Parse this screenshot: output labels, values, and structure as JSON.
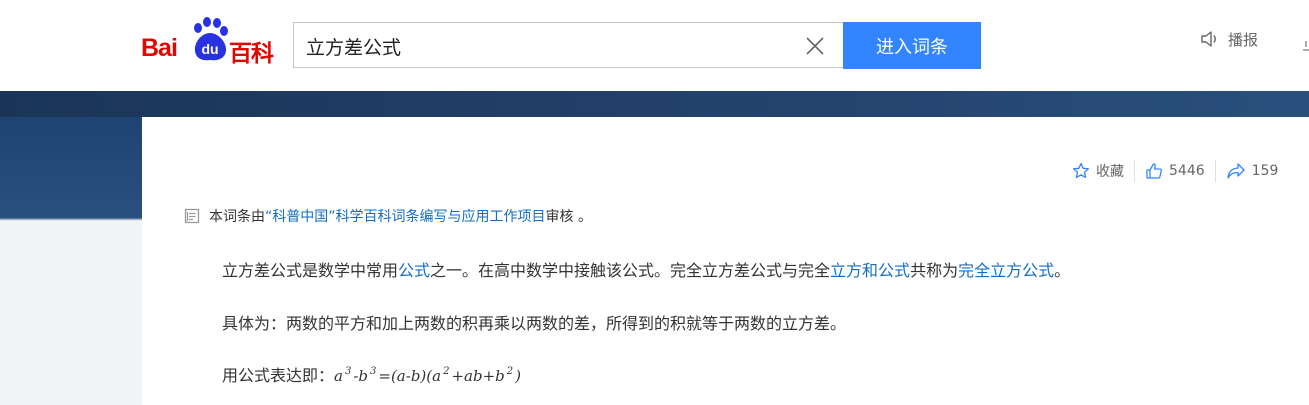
{
  "logo": {
    "bai": "Bai",
    "du": "du",
    "baike": "百科"
  },
  "search": {
    "value": "立方差公式",
    "button": "进入词条"
  },
  "broadcast": {
    "label": "播报"
  },
  "actions": {
    "favorite": "收藏",
    "likes": "5446",
    "shares": "159"
  },
  "notice": {
    "prefix": "本词条由",
    "link": "“科普中国”科学百科词条编写与应用工作项目",
    "suffix": " 审核 。"
  },
  "paragraphs": {
    "p1": {
      "t1": "立方差公式是数学中常用",
      "l1": "公式",
      "t2": "之一。在高中数学中接触该公式。完全立方差公式与完全",
      "l2": "立方和公式",
      "t3": "共称为",
      "l3": "完全立方公式",
      "t4": "。"
    },
    "p2": {
      "text": "具体为：两数的平方和加上两数的积再乘以两数的差，所得到的积就等于两数的立方差。"
    },
    "p3": {
      "prefix": "用公式表达即：",
      "a": "a",
      "exp1": "3",
      "minus_b": "-b",
      "exp2": "3",
      "mid": "=(a-b)(a",
      "exp3": "2",
      "tail": "+ab+b",
      "exp4": "2",
      "close": ")"
    }
  },
  "colors": {
    "brand_red": "#e10602",
    "brand_blue": "#3385ff",
    "link": "#136ec2"
  }
}
